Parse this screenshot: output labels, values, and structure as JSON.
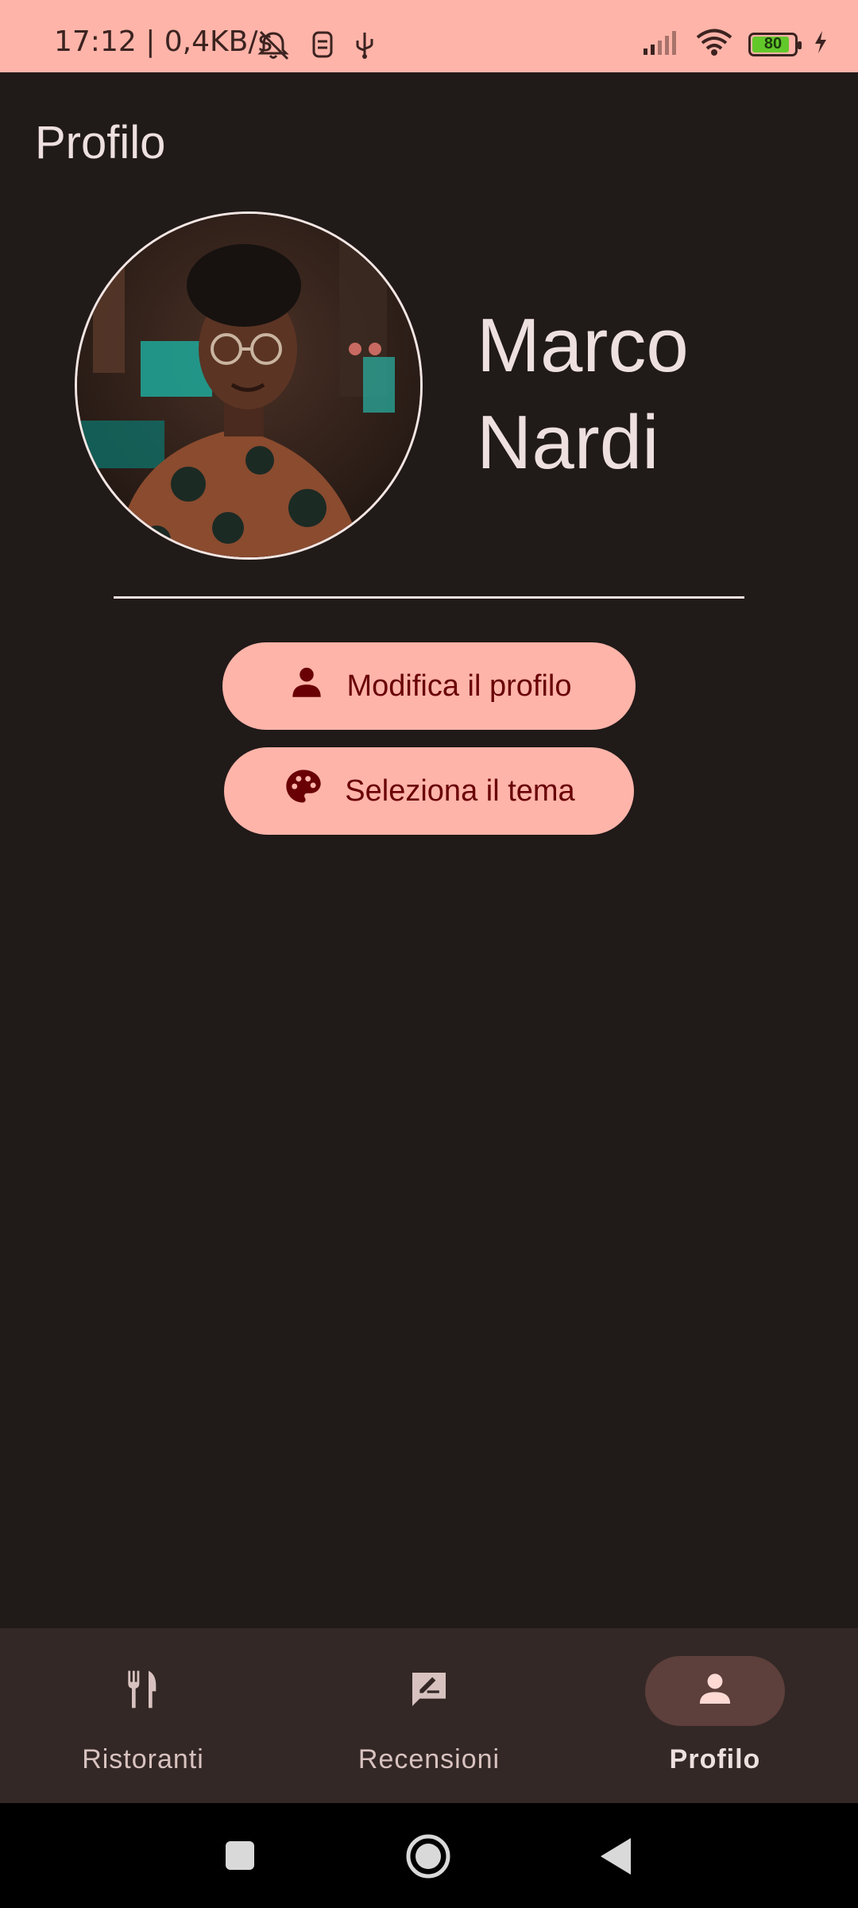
{
  "status_bar": {
    "time": "17:12 | 0,4KB/s",
    "battery": "80",
    "icons": [
      "alarm-off-icon",
      "sim-icon",
      "usb-icon",
      "signal-icon",
      "wifi-icon",
      "battery-icon",
      "charging-icon"
    ]
  },
  "header": {
    "title": "Profilo"
  },
  "profile": {
    "name": "Marco Nardi",
    "avatar_icon": "user-photo"
  },
  "actions": {
    "edit_profile": {
      "label": "Modifica il profilo",
      "icon": "person-icon"
    },
    "select_theme": {
      "label": "Seleziona il tema",
      "icon": "palette-icon"
    }
  },
  "bottom_nav": {
    "items": [
      {
        "label": "Ristoranti",
        "icon": "restaurant-icon",
        "active": false
      },
      {
        "label": "Recensioni",
        "icon": "rate-review-icon",
        "active": false
      },
      {
        "label": "Profilo",
        "icon": "person-icon",
        "active": true
      }
    ]
  },
  "colors": {
    "background": "#201a19",
    "accent": "#ffb4a9",
    "on_accent": "#690005",
    "nav_background": "#332826",
    "nav_active_indicator": "#5d3f3b",
    "text": "#ede0de"
  }
}
